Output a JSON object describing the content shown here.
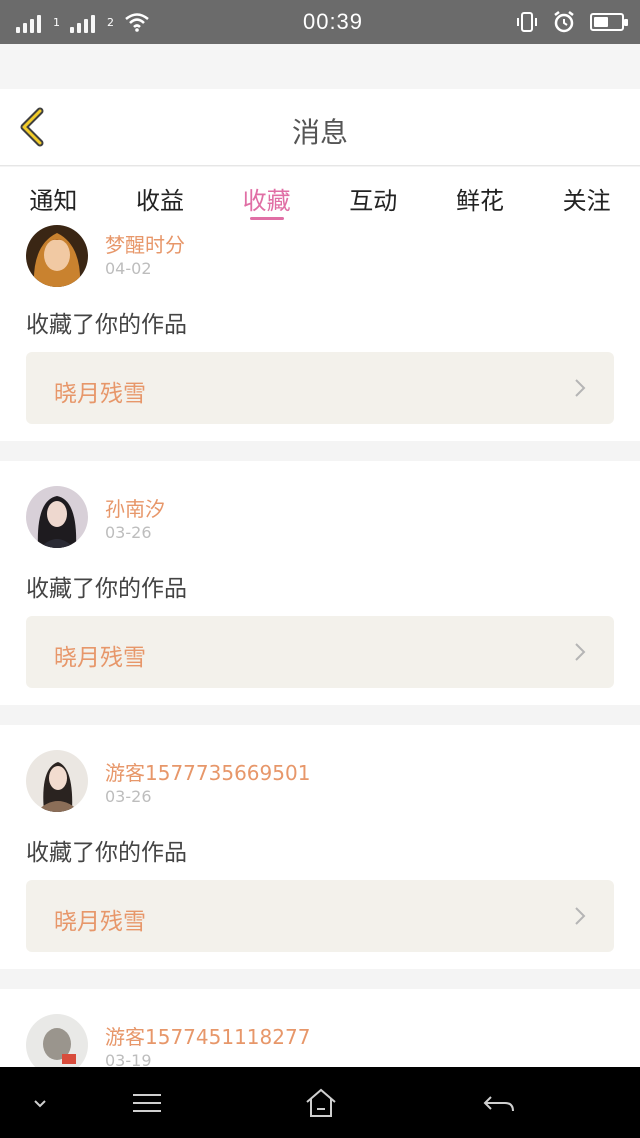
{
  "status_bar": {
    "time": "00:39",
    "sim1": "1",
    "sim2": "2"
  },
  "header": {
    "title": "消息"
  },
  "tabs": [
    {
      "label": "通知"
    },
    {
      "label": "收益"
    },
    {
      "label": "收藏",
      "active": true
    },
    {
      "label": "互动"
    },
    {
      "label": "鲜花"
    },
    {
      "label": "关注"
    }
  ],
  "items": [
    {
      "username": "梦醒时分",
      "date": "04-02",
      "action": "收藏了你的作品",
      "work": "晓月残雪"
    },
    {
      "username": "孙南汐",
      "date": "03-26",
      "action": "收藏了你的作品",
      "work": "晓月残雪"
    },
    {
      "username": "游客1577735669501",
      "date": "03-26",
      "action": "收藏了你的作品",
      "work": "晓月残雪"
    },
    {
      "username": "游客1577451118277",
      "date": "03-19"
    }
  ],
  "colors": {
    "accent": "#e06fa5",
    "name": "#e7976a",
    "work_bg": "#f3f1eb"
  },
  "icons": {
    "back": "chevron-left-icon",
    "item_arrow": "chevron-right-icon",
    "nav": [
      "chevron-down-icon",
      "menu-icon",
      "home-icon",
      "back-arrow-icon"
    ]
  }
}
